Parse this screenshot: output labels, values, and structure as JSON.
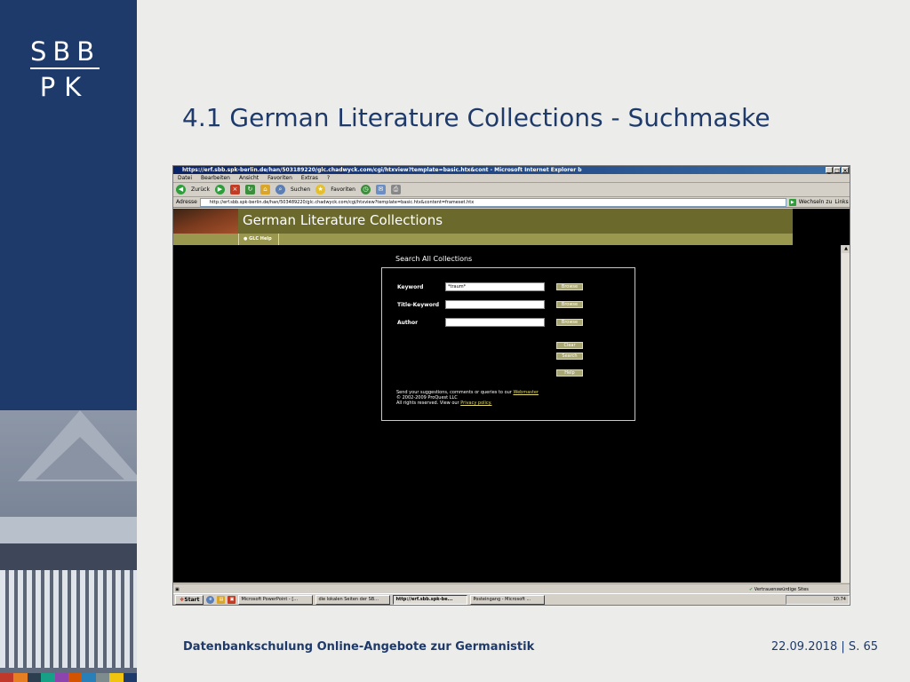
{
  "slide": {
    "logo_top": "SBB",
    "logo_bottom": "PK",
    "title": "4.1 German Literature Collections - Suchmaske",
    "footer_left": "Datenbankschulung Online-Angebote zur Germanistik",
    "footer_right": "22.09.2018 | S. 65"
  },
  "browser": {
    "title": "https://erf.sbb.spk-berlin.de/han/503189220/glc.chadwyck.com/cgi/htxview?template=basic.htx&cont - Microsoft Internet Explorer b",
    "menu": [
      "Datei",
      "Bearbeiten",
      "Ansicht",
      "Favoriten",
      "Extras",
      "?"
    ],
    "toolbar": {
      "back": "Zurück",
      "search": "Suchen",
      "favorites": "Favoriten"
    },
    "address_label": "Adresse",
    "address_url": "http://erf.sbb.spk-berlin.de/han/503489220/glc.chadwyck.com/cgi/htxview?template=basic.htx&content=frameset.htx",
    "go_label": "Wechseln zu",
    "links_label": "Links",
    "status_zone": "Vertrauenswürdige Sites"
  },
  "glc": {
    "header_title": "German Literature Collections",
    "help_link": "● GLC Help",
    "search_heading": "Search All Collections",
    "fields": [
      {
        "label": "Keyword",
        "value": "*traum*"
      },
      {
        "label": "Title-Keyword",
        "value": ""
      },
      {
        "label": "Author",
        "value": ""
      }
    ],
    "browse_label": "Browse",
    "clear_label": "Clear",
    "search_label": "Search",
    "help_label": "Help",
    "footer_line1": "Send your suggestions, comments or queries to our",
    "footer_link1": "Webmaster",
    "footer_line2": "© 2002-2009 ProQuest LLC",
    "footer_line3": "All rights reserved. View our",
    "footer_link2": "Privacy policy."
  },
  "taskbar": {
    "start": "Start",
    "tasks": [
      "Microsoft PowerPoint - [...",
      "die lokalen Seiten der SB...",
      "http://erf.sbb.spk-be...",
      "Posteingang - Microsoft ..."
    ],
    "clock": "10:74"
  },
  "colors": {
    "slide_blue": "#1e3a6b",
    "glc_olive": "#6b6a2c",
    "glc_nav": "#9a984e",
    "button_olive": "#a8a672"
  }
}
